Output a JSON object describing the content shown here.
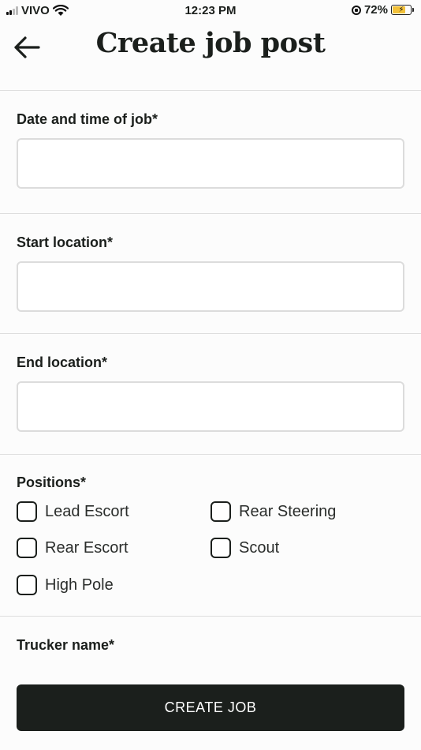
{
  "status_bar": {
    "carrier": "VIVO",
    "time": "12:23 PM",
    "battery": "72%",
    "battery_level": 0.72,
    "icons": [
      "signal-icon",
      "wifi-icon",
      "orientation-lock-icon",
      "battery-icon"
    ]
  },
  "header": {
    "title": "Create job post",
    "back_icon": "arrow-left-icon"
  },
  "fields": {
    "date_time": {
      "label": "Date and time of job*",
      "value": "",
      "placeholder": ""
    },
    "start_location": {
      "label": "Start location*",
      "value": "",
      "placeholder": ""
    },
    "end_location": {
      "label": "End location*",
      "value": "",
      "placeholder": ""
    },
    "trucker_name": {
      "label": "Trucker name*"
    }
  },
  "positions": {
    "label": "Positions*",
    "options": [
      {
        "label": "Lead Escort",
        "checked": false
      },
      {
        "label": "Rear Steering",
        "checked": false
      },
      {
        "label": "Rear Escort",
        "checked": false
      },
      {
        "label": "Scout",
        "checked": false
      },
      {
        "label": "High Pole",
        "checked": false
      }
    ]
  },
  "actions": {
    "create_label": "CREATE JOB"
  },
  "colors": {
    "primary": "#1b1f1c",
    "background": "#fcfcfc",
    "divider": "#dedede",
    "input_border": "#dcdcdc",
    "battery_fill": "#f2c13a"
  }
}
